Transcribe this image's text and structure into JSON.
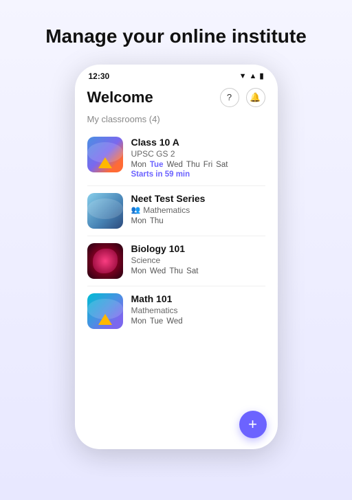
{
  "hero": {
    "title": "Manage your online institute"
  },
  "header": {
    "app_title": "Welcome",
    "help_icon": "?",
    "bell_icon": "🔔"
  },
  "classrooms": {
    "label": "My classrooms (4)",
    "items": [
      {
        "name": "Class 10 A",
        "subtitle": "UPSC GS 2",
        "days": [
          "Mon",
          "Tue",
          "Wed",
          "Thu",
          "Fri",
          "Sat"
        ],
        "highlight_day": "Tue",
        "starts_in": "Starts in 59 min",
        "thumb_type": "class10"
      },
      {
        "name": "Neet Test Series",
        "subtitle": "Mathematics",
        "days": [
          "Mon",
          "Thu"
        ],
        "highlight_day": null,
        "starts_in": null,
        "thumb_type": "neet"
      },
      {
        "name": "Biology 101",
        "subtitle": "Science",
        "days": [
          "Mon",
          "Wed",
          "Thu",
          "Sat"
        ],
        "highlight_day": null,
        "starts_in": null,
        "thumb_type": "biology"
      },
      {
        "name": "Math 101",
        "subtitle": "Mathematics",
        "days": [
          "Mon",
          "Tue",
          "Wed"
        ],
        "highlight_day": null,
        "starts_in": null,
        "thumb_type": "math"
      }
    ]
  },
  "status_bar": {
    "time": "12:30"
  },
  "fab": {
    "label": "+"
  }
}
